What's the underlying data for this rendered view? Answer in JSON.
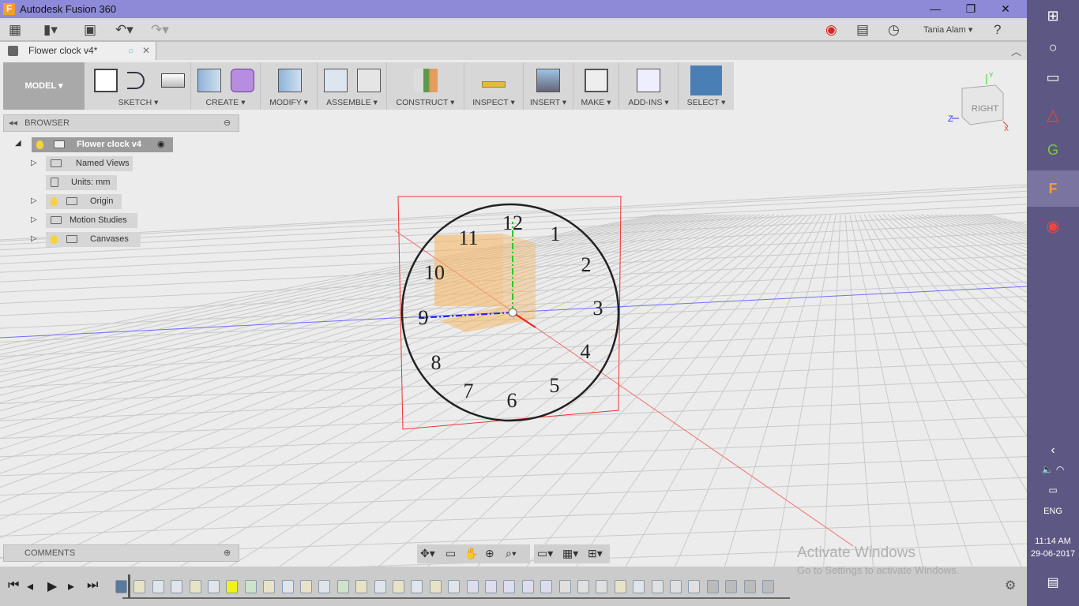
{
  "app": {
    "title": "Autodesk Fusion 360",
    "brand_color": "#f39c34",
    "titlebar_color": "#8d8ad8"
  },
  "window_controls": {
    "minimize": "—",
    "maximize": "❐",
    "close": "✕"
  },
  "qat": {
    "user": "Tania Alam ▾",
    "help": "?"
  },
  "document_tab": {
    "label": "Flower clock v4*"
  },
  "toolbar": {
    "workspace": "MODEL ▾",
    "groups": [
      {
        "label": "SKETCH ▾"
      },
      {
        "label": "CREATE ▾"
      },
      {
        "label": "MODIFY ▾"
      },
      {
        "label": "ASSEMBLE ▾"
      },
      {
        "label": "CONSTRUCT ▾"
      },
      {
        "label": "INSPECT ▾"
      },
      {
        "label": "INSERT ▾"
      },
      {
        "label": "MAKE ▾"
      },
      {
        "label": "ADD-INS ▾"
      },
      {
        "label": "SELECT ▾"
      }
    ]
  },
  "browser": {
    "title": "BROWSER",
    "root": "Flower clock v4",
    "items": [
      {
        "label": "Named Views"
      },
      {
        "label": "Units: mm"
      },
      {
        "label": "Origin"
      },
      {
        "label": "Motion Studies"
      },
      {
        "label": "Canvases"
      }
    ]
  },
  "comments": {
    "title": "COMMENTS"
  },
  "viewcube": {
    "face": "RIGHT",
    "axis_z": "Z",
    "axis_x": "X",
    "axis_y": "Y"
  },
  "clock_numbers": [
    "12",
    "1",
    "2",
    "3",
    "4",
    "5",
    "6",
    "7",
    "8",
    "9",
    "10",
    "11"
  ],
  "watermark": {
    "line1": "Activate Windows",
    "line2": "Go to Settings to activate Windows."
  },
  "timeline": {
    "features": [
      "canvas",
      "sketch",
      "extrude",
      "extrude",
      "sketch",
      "extrude",
      "plane-highlight",
      "plane",
      "sketch",
      "extrude",
      "sketch",
      "extrude",
      "plane",
      "sketch",
      "extrude",
      "sketch",
      "extrude",
      "sketch",
      "extrude",
      "joint",
      "joint",
      "joint",
      "joint",
      "joint",
      "revolve",
      "revolve",
      "revolve",
      "sketch",
      "extrude",
      "fillet",
      "fillet",
      "fillet",
      "thread",
      "thread",
      "thread",
      "thread"
    ]
  },
  "taskbar": {
    "language": "ENG",
    "time": "11:14 AM",
    "date": "29-06-2017"
  }
}
